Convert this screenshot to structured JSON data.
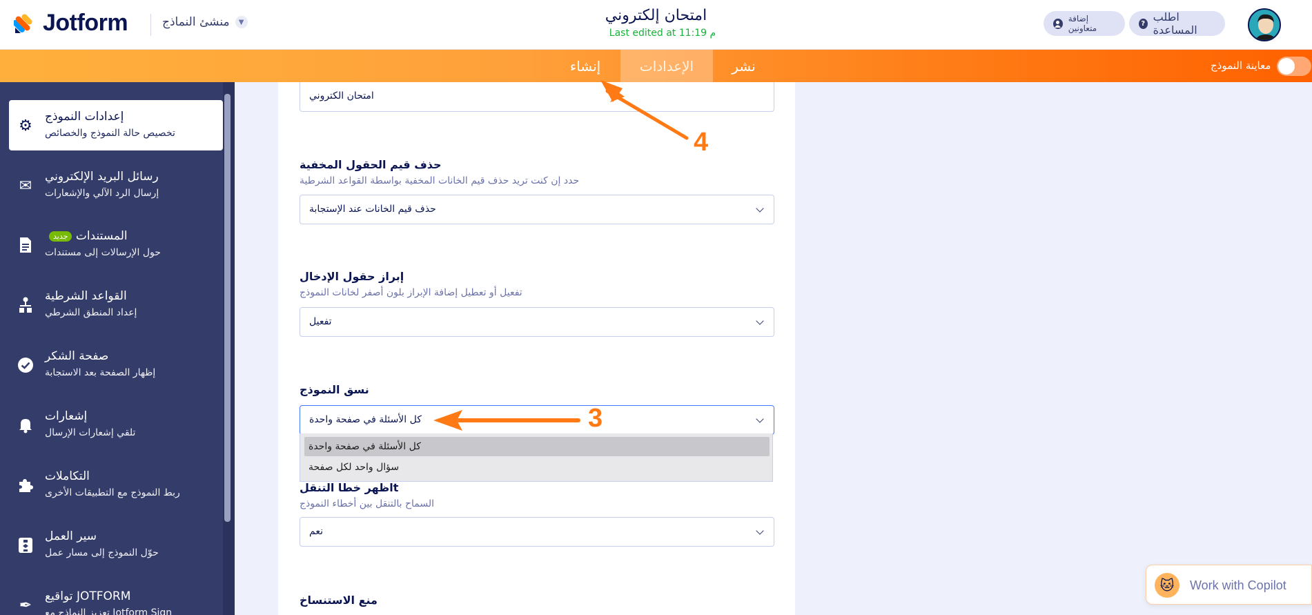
{
  "brand": {
    "name": "Jotform"
  },
  "header": {
    "builder_menu": "منشئ النماذج",
    "form_title": "امتحان إلكتروني",
    "last_edited": "Last edited at 11:19 م",
    "help_label": "اطلب المساعدة",
    "invite_label": "إضافة متعاونين"
  },
  "nav": {
    "tabs": [
      {
        "label": "إنشاء"
      },
      {
        "label": "الإعدادات"
      },
      {
        "label": "نشر"
      }
    ],
    "preview_label": "معاينة النموذج"
  },
  "sidebar": {
    "items": [
      {
        "title": "إعدادات النموذج",
        "subtitle": "تخصيص حالة النموذج والخصائص",
        "icon": "gear-icon"
      },
      {
        "title": "رسائل البريد الإلكتروني",
        "subtitle": "إرسال الرد الآلي والإشعارات",
        "icon": "mail-icon"
      },
      {
        "title": "المستندات",
        "badge": "جديد",
        "subtitle": "حول الإرسالات إلى مستندات",
        "icon": "document-icon"
      },
      {
        "title": "القواعد الشرطية",
        "subtitle": "إعداد المنطق الشرطي",
        "icon": "conditions-icon"
      },
      {
        "title": "صفحة الشكر",
        "subtitle": "إظهار الصفحة بعد الاستجابة",
        "icon": "check-circle-icon"
      },
      {
        "title": "إشعارات",
        "subtitle": "تلقي إشعارات الإرسال",
        "icon": "bell-icon"
      },
      {
        "title": "التكاملات",
        "subtitle": "ربط النموذج مع التطبيقات الأخرى",
        "icon": "puzzle-icon"
      },
      {
        "title": "سير العمل",
        "subtitle": "حوّل النموذج إلى مسار عمل",
        "icon": "workflow-icon"
      },
      {
        "title": "تواقيع JOTFORM",
        "subtitle": "تعزيز النماذج مع Jotform Sign",
        "icon": "pen-icon"
      }
    ]
  },
  "settings": {
    "form_title_value": "امتحان الكتروني",
    "hidden_fields": {
      "label": "حذف قيم الحقول المخفية",
      "description": "حدد إن كنت تريد حذف قيم الخانات المخفية بواسطة القواعد الشرطية",
      "value": "حذف قيم الخانات عند الإستجابة"
    },
    "highlight": {
      "label": "إبراز حقول الإدخال",
      "description": "تفعيل أو تعطيل إضافة الإبراز بلون أصفر لخانات النموذج",
      "value": "تفعيل"
    },
    "layout": {
      "label": "نسق النموذج",
      "value": "كل الأسئلة في صفحة واحدة",
      "options": [
        "كل الأسئلة في صفحة واحدة",
        "سؤال واحد لكل صفحة"
      ]
    },
    "nav_errors": {
      "label": "اظهر خطا التنقلt",
      "description": "السماح بالتنقل بين أخطاء النموذج",
      "value": "نعم"
    },
    "prevent_clone": {
      "label": "منع الاستنساخ"
    }
  },
  "annotations": {
    "step_3": "3",
    "step_4": "4",
    "color": "#ff7a14"
  },
  "copilot": {
    "label": "Work with Copilot"
  }
}
